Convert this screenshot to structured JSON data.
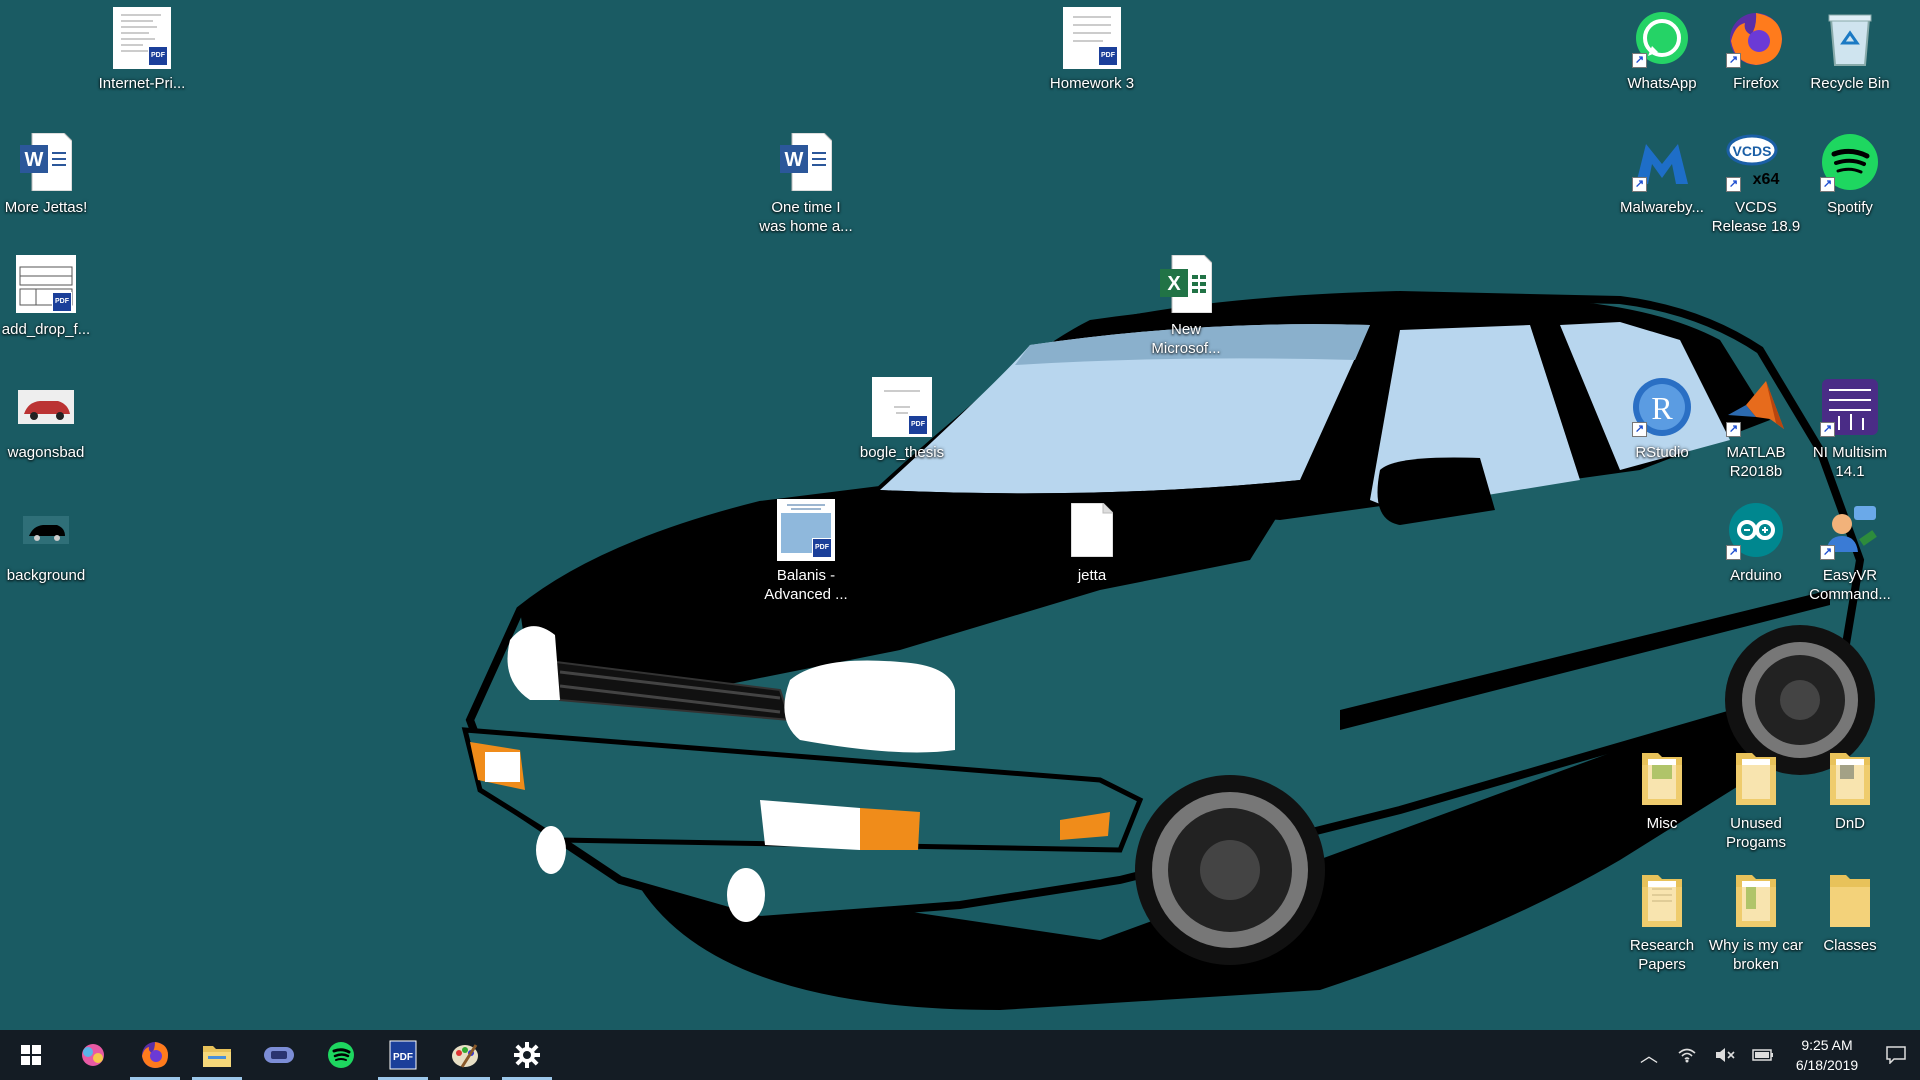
{
  "desktop_icons": {
    "internet_pri": "Internet-Pri...",
    "homework3": "Homework 3",
    "whatsapp": "WhatsApp",
    "firefox": "Firefox",
    "recycle_bin": "Recycle Bin",
    "more_jettas": "More Jettas!",
    "one_time_line1": "One time I",
    "one_time_line2": "was home a...",
    "malwarebytes": "Malwareby...",
    "vcds_line1": "VCDS",
    "vcds_line2": "Release 18.9",
    "spotify": "Spotify",
    "add_drop": "add_drop_f...",
    "new_ms_line1": "New",
    "new_ms_line2": "Microsof...",
    "wagonsbad": "wagonsbad",
    "bogle_thesis": "bogle_thesis",
    "rstudio": "RStudio",
    "matlab_line1": "MATLAB",
    "matlab_line2": "R2018b",
    "multisim_line1": "NI Multisim",
    "multisim_line2": "14.1",
    "background": "background",
    "balanis_line1": "Balanis -",
    "balanis_line2": "Advanced ...",
    "jetta": "jetta",
    "arduino": "Arduino",
    "easyvr_line1": "EasyVR",
    "easyvr_line2": "Command...",
    "misc": "Misc",
    "unused_line1": "Unused",
    "unused_line2": "Progams",
    "dnd": "DnD",
    "research_line1": "Research",
    "research_line2": "Papers",
    "why_line1": "Why is my car",
    "why_line2": "broken",
    "classes": "Classes"
  },
  "vcds_badge": "x64",
  "taskbar": {
    "pinned": [
      "start-icon",
      "paint-3d-icon",
      "firefox-icon",
      "file-explorer-icon",
      "gamepad-app-icon",
      "spotify-icon",
      "pdf-app-icon",
      "paint-icon",
      "settings-icon"
    ]
  },
  "tray": {
    "time": "9:25 AM",
    "date": "6/18/2019"
  },
  "colors": {
    "desktop": "#1a5b63",
    "taskbar": "#141c24",
    "car_body": "#1d5f66",
    "glass": "#b8d6ee"
  }
}
